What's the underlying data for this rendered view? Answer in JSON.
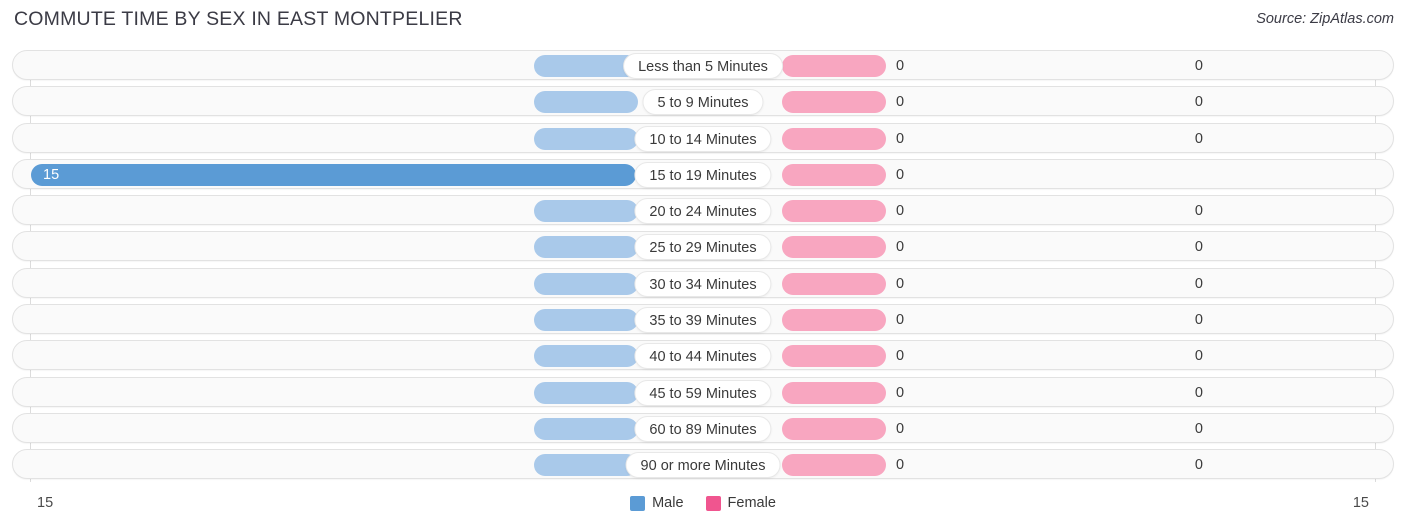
{
  "header": {
    "title": "COMMUTE TIME BY SEX IN EAST MONTPELIER",
    "source": "Source: ZipAtlas.com"
  },
  "axis": {
    "left_label": "15",
    "right_label": "15"
  },
  "legend": {
    "items": [
      {
        "label": "Male",
        "color": "#5b9bd5"
      },
      {
        "label": "Female",
        "color": "#f0558f"
      }
    ]
  },
  "colors": {
    "male_default": "#a9c9ea",
    "male_max": "#5b9bd5",
    "female_default": "#f8a6c0",
    "female_max": "#f06597",
    "track": "#fafafa",
    "track_border": "#e2e2e2"
  },
  "chart_data": {
    "type": "bar",
    "title": "COMMUTE TIME BY SEX IN EAST MONTPELIER",
    "subtitle": "",
    "xlabel": "",
    "ylabel": "",
    "orientation": "horizontal",
    "style": "diverging-tornado",
    "legend_position": "bottom-center",
    "grid": true,
    "xlim": [
      15,
      15
    ],
    "axis_max": 15,
    "categories": [
      "Less than 5 Minutes",
      "5 to 9 Minutes",
      "10 to 14 Minutes",
      "15 to 19 Minutes",
      "20 to 24 Minutes",
      "25 to 29 Minutes",
      "30 to 34 Minutes",
      "35 to 39 Minutes",
      "40 to 44 Minutes",
      "45 to 59 Minutes",
      "60 to 89 Minutes",
      "90 or more Minutes"
    ],
    "series": [
      {
        "name": "Male",
        "side": "left",
        "values": [
          0,
          0,
          0,
          15,
          0,
          0,
          0,
          0,
          0,
          0,
          0,
          0
        ],
        "labels": [
          "0",
          "0",
          "0",
          "15",
          "0",
          "0",
          "0",
          "0",
          "0",
          "0",
          "0",
          "0"
        ]
      },
      {
        "name": "Female",
        "side": "right",
        "values": [
          0,
          0,
          0,
          0,
          0,
          0,
          0,
          0,
          0,
          0,
          0,
          0
        ],
        "labels": [
          "0",
          "0",
          "0",
          "0",
          "0",
          "0",
          "0",
          "0",
          "0",
          "0",
          "0",
          "0"
        ]
      }
    ]
  }
}
